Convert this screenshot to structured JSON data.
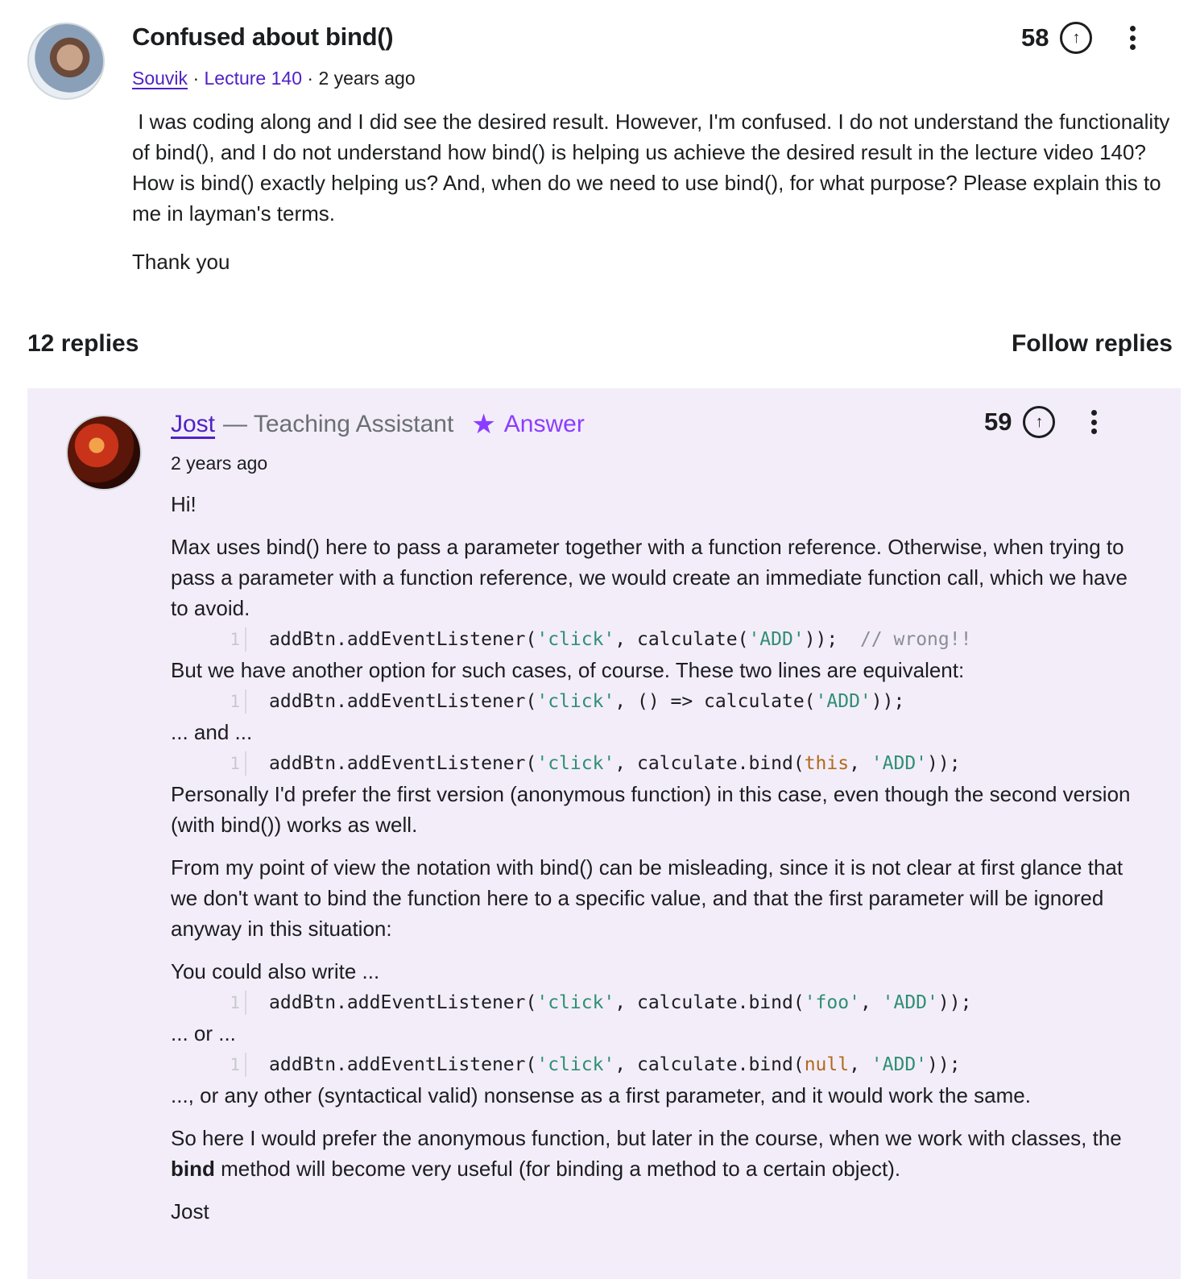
{
  "question": {
    "title": "Confused about bind()",
    "author": "Souvik",
    "lecture": "Lecture 140",
    "time": "2 years ago",
    "votes": "58",
    "body": [
      " I was coding along and I did see the desired result. However, I'm confused. I do not understand the functionality of bind(), and I do not understand how bind() is helping us achieve the desired result in the lecture video 140? How is bind() exactly helping us? And, when do we need to use bind(), for what purpose? Please explain this to me in layman's terms.",
      "Thank you"
    ]
  },
  "replies": {
    "count_label": "12 replies",
    "follow_label": "Follow replies"
  },
  "answer": {
    "author": "Jost",
    "role": "— Teaching Assistant",
    "badge": "Answer",
    "time": "2 years ago",
    "votes": "59",
    "p1": "Hi!",
    "p2": "Max uses bind() here to pass a parameter together with a function reference. Otherwise, when trying to pass a parameter with a function reference, we would create an immediate function call, which we have to avoid.",
    "code1": {
      "ln": "1",
      "a": "addBtn.addEventListener(",
      "b": "'click'",
      "c": ", calculate(",
      "d": "'ADD'",
      "e": "));  ",
      "f": "// wrong!!"
    },
    "p3": "But we have another option for such cases, of course. These two lines are equivalent:",
    "code2": {
      "ln": "1",
      "a": "addBtn.addEventListener(",
      "b": "'click'",
      "c": ", () => calculate(",
      "d": "'ADD'",
      "e": "));"
    },
    "p4": "... and ...",
    "code3": {
      "ln": "1",
      "a": "addBtn.addEventListener(",
      "b": "'click'",
      "c": ", calculate.bind(",
      "d": "this",
      "e": ", ",
      "f": "'ADD'",
      "g": "));"
    },
    "p5": "Personally I'd prefer the first version (anonymous function) in this case, even though the second version (with bind()) works as well.",
    "p6": "From my point of view the notation with bind() can be misleading, since it is not clear at first glance that we don't want to bind the function here to a specific value, and that the first parameter will be ignored anyway in this situation:",
    "p7": "You could also write ...",
    "code4": {
      "ln": "1",
      "a": "addBtn.addEventListener(",
      "b": "'click'",
      "c": ", calculate.bind(",
      "d": "'foo'",
      "e": ", ",
      "f": "'ADD'",
      "g": "));"
    },
    "p8": "... or ...",
    "code5": {
      "ln": "1",
      "a": "addBtn.addEventListener(",
      "b": "'click'",
      "c": ", calculate.bind(",
      "d": "null",
      "e": ", ",
      "f": "'ADD'",
      "g": "));"
    },
    "p9": "..., or any other (syntactical valid) nonsense as a first parameter, and it would work the same.",
    "p10_a": "So here I would prefer the anonymous function, but later in the course, when we work with classes, the ",
    "p10_b": "bind",
    "p10_c": " method will become very useful (for binding a method to a certain object).",
    "p11": "Jost"
  },
  "icons": {
    "upvote": "arrow-up-circle-icon",
    "more": "vertical-dots-icon",
    "badge": "star-icon"
  },
  "colors": {
    "link": "#5022c3",
    "accent": "#8b3dff",
    "answer_bg": "#f3edfa",
    "code_string": "#2f8f72",
    "code_keyword": "#b06a1c"
  }
}
